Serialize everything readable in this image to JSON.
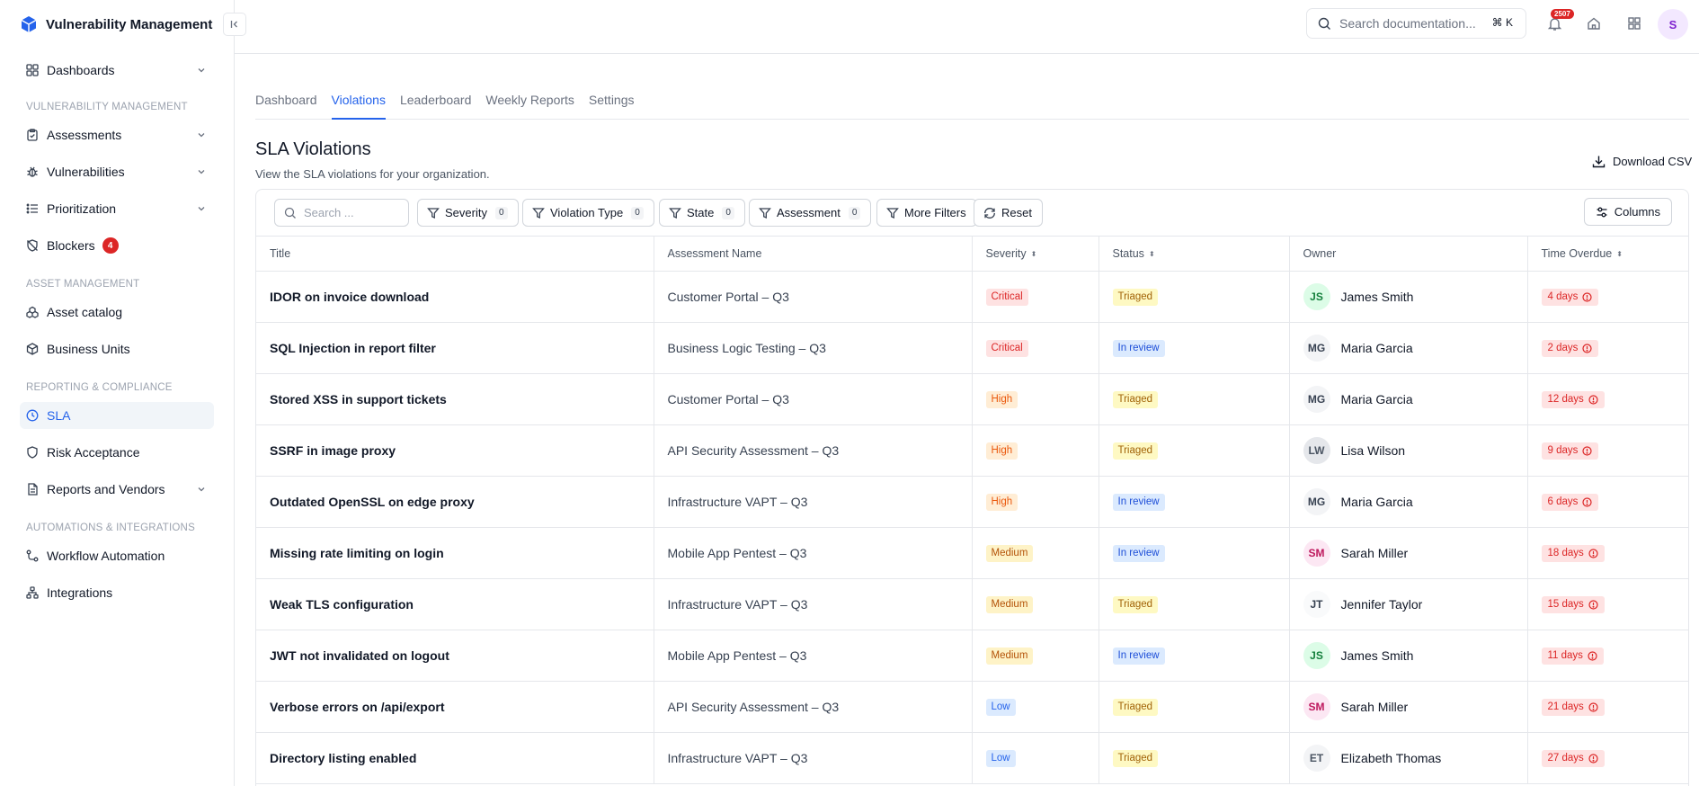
{
  "app": {
    "title": "Vulnerability Management",
    "collapse_icon": "collapse-sidebar-icon"
  },
  "sidebar": {
    "top_items": [
      {
        "label": "Dashboards",
        "icon": "grid-icon",
        "chevron": true
      }
    ],
    "sections": [
      {
        "label": "VULNERABILITY MANAGEMENT"
      },
      {
        "label": "ASSET MANAGEMENT"
      },
      {
        "label": "REPORTING & COMPLIANCE"
      },
      {
        "label": "AUTOMATIONS & INTEGRATIONS"
      }
    ],
    "items": {
      "dashboards": "Dashboards",
      "assessments": "Assessments",
      "vulnerabilities": "Vulnerabilities",
      "prioritization": "Prioritization",
      "blockers": "Blockers",
      "blockers_count": "4",
      "asset_catalog": "Asset catalog",
      "business_units": "Business Units",
      "sla": "SLA",
      "risk_acceptance": "Risk Acceptance",
      "reports_vendors": "Reports and Vendors",
      "workflow_automation": "Workflow Automation",
      "integrations": "Integrations"
    }
  },
  "topbar": {
    "search_placeholder": "Search documentation...",
    "shortcut": "⌘ K",
    "notification_count": "2507",
    "user_initial": "S"
  },
  "tabs": [
    "Dashboard",
    "Violations",
    "Leaderboard",
    "Weekly Reports",
    "Settings"
  ],
  "active_tab": "Violations",
  "page": {
    "title": "SLA Violations",
    "subtitle": "View the SLA violations for your organization.",
    "download_label": "Download CSV"
  },
  "filters": {
    "search_placeholder": "Search ...",
    "severity": {
      "label": "Severity",
      "count": "0"
    },
    "violation_type": {
      "label": "Violation Type",
      "count": "0"
    },
    "state": {
      "label": "State",
      "count": "0"
    },
    "assessment": {
      "label": "Assessment",
      "count": "0"
    },
    "more_filters": "More Filters",
    "reset": "Reset",
    "columns": "Columns"
  },
  "table": {
    "headers": {
      "title": "Title",
      "assessment": "Assessment Name",
      "severity": "Severity",
      "status": "Status",
      "owner": "Owner",
      "overdue": "Time Overdue"
    },
    "rows": [
      {
        "title": "IDOR on invoice download",
        "assessment": "Customer Portal – Q3",
        "severity": "Critical",
        "status": "Triaged",
        "initials": "JS",
        "owner": "James Smith",
        "overdue": "4 days"
      },
      {
        "title": "SQL Injection in report filter",
        "assessment": "Business Logic Testing – Q3",
        "severity": "Critical",
        "status": "In review",
        "initials": "MG",
        "owner": "Maria Garcia",
        "overdue": "2 days"
      },
      {
        "title": "Stored XSS in support tickets",
        "assessment": "Customer Portal – Q3",
        "severity": "High",
        "status": "Triaged",
        "initials": "MG",
        "owner": "Maria Garcia",
        "overdue": "12 days"
      },
      {
        "title": "SSRF in image proxy",
        "assessment": "API Security Assessment – Q3",
        "severity": "High",
        "status": "Triaged",
        "initials": "LW",
        "owner": "Lisa Wilson",
        "overdue": "9 days"
      },
      {
        "title": "Outdated OpenSSL on edge proxy",
        "assessment": "Infrastructure VAPT – Q3",
        "severity": "High",
        "status": "In review",
        "initials": "MG",
        "owner": "Maria Garcia",
        "overdue": "6 days"
      },
      {
        "title": "Missing rate limiting on login",
        "assessment": "Mobile App Pentest – Q3",
        "severity": "Medium",
        "status": "In review",
        "initials": "SM",
        "owner": "Sarah Miller",
        "overdue": "18 days"
      },
      {
        "title": "Weak TLS configuration",
        "assessment": "Infrastructure VAPT – Q3",
        "severity": "Medium",
        "status": "Triaged",
        "initials": "JT",
        "owner": "Jennifer Taylor",
        "overdue": "15 days"
      },
      {
        "title": "JWT not invalidated on logout",
        "assessment": "Mobile App Pentest – Q3",
        "severity": "Medium",
        "status": "In review",
        "initials": "JS",
        "owner": "James Smith",
        "overdue": "11 days"
      },
      {
        "title": "Verbose errors on /api/export",
        "assessment": "API Security Assessment – Q3",
        "severity": "Low",
        "status": "Triaged",
        "initials": "SM",
        "owner": "Sarah Miller",
        "overdue": "21 days"
      },
      {
        "title": "Directory listing enabled",
        "assessment": "Infrastructure VAPT – Q3",
        "severity": "Low",
        "status": "Triaged",
        "initials": "ET",
        "owner": "Elizabeth Thomas",
        "overdue": "27 days"
      }
    ]
  },
  "colors": {
    "accent": "#2563eb",
    "critical_bg": "#fee2e2",
    "critical_fg": "#dc2626",
    "high_bg": "#ffedd5",
    "high_fg": "#ea580c",
    "medium_bg": "#fef3c7",
    "medium_fg": "#b45309",
    "low_bg": "#dbeafe",
    "low_fg": "#2563eb",
    "triaged_bg": "#fef9c3",
    "triaged_fg": "#a16207",
    "review_bg": "#dbeafe",
    "review_fg": "#1d4ed8"
  }
}
